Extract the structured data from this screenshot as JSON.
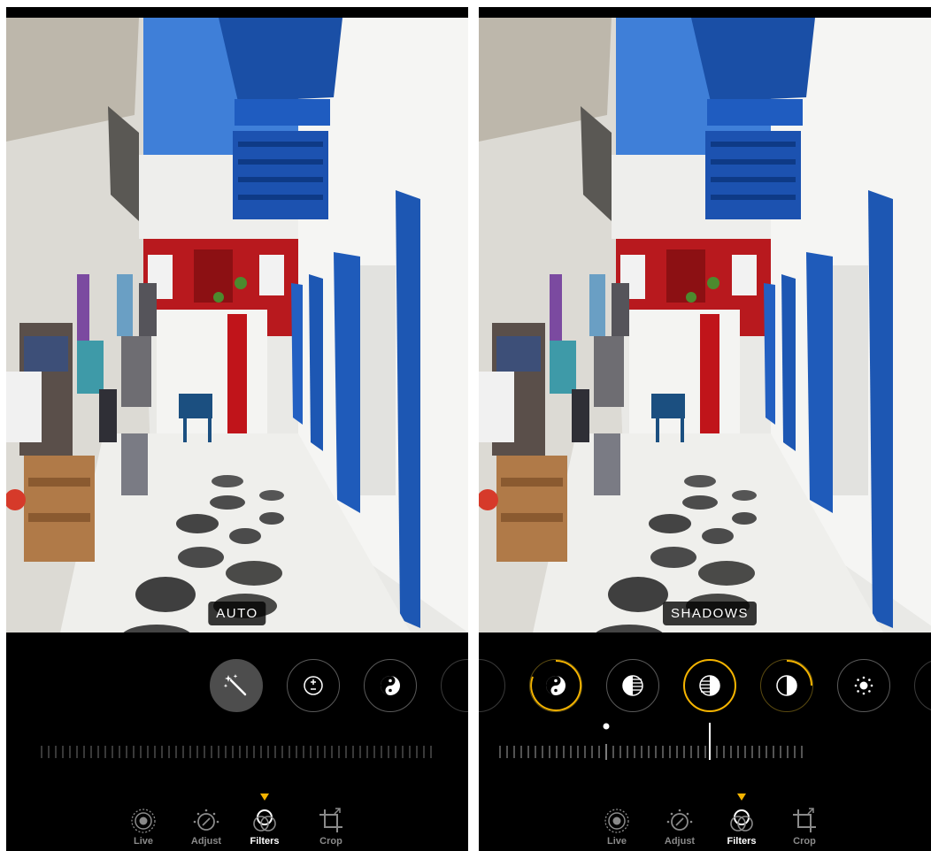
{
  "colors": {
    "accent": "#f5b400",
    "background": "#000000",
    "inactive": "#8a8a8a"
  },
  "screens": [
    {
      "mode_label": "AUTO",
      "dials": [
        {
          "icon": "magic-wand-icon",
          "state": "filled"
        },
        {
          "icon": "exposure-icon",
          "state": "normal"
        },
        {
          "icon": "brilliance-icon",
          "state": "normal"
        }
      ]
    },
    {
      "mode_label": "SHADOWS",
      "dials": [
        {
          "icon": "brilliance-icon",
          "state": "active"
        },
        {
          "icon": "highlights-icon",
          "state": "normal"
        },
        {
          "icon": "shadows-icon",
          "state": "selected"
        },
        {
          "icon": "contrast-icon",
          "state": "active"
        },
        {
          "icon": "brightness-icon",
          "state": "normal"
        }
      ]
    }
  ],
  "tabs": [
    {
      "label": "Live",
      "icon": "live-photo-icon"
    },
    {
      "label": "Adjust",
      "icon": "adjust-dial-icon"
    },
    {
      "label": "Filters",
      "icon": "filters-icon",
      "active": true
    },
    {
      "label": "Crop",
      "icon": "crop-icon"
    }
  ]
}
